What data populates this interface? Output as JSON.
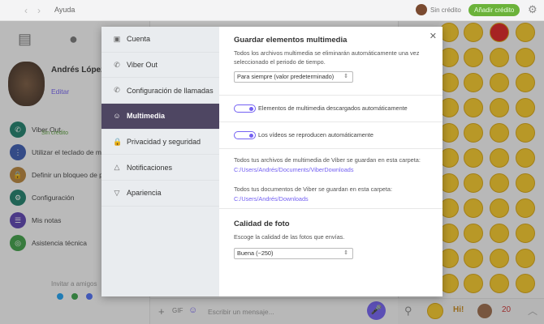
{
  "topbar": {
    "help": "Ayuda",
    "credit_status": "Sin crédito",
    "add_credit": "Añadir crédito"
  },
  "profile": {
    "name": "Andrés López",
    "edit": "Editar"
  },
  "left_menu": [
    {
      "label": "Viber Out",
      "sub": "Sin crédito",
      "color": "#1d7f6a"
    },
    {
      "label": "Utilizar el teclado de ma",
      "color": "#3a5bb0"
    },
    {
      "label": "Definir un bloqueo de p",
      "color": "#b8843a"
    },
    {
      "label": "Configuración",
      "color": "#1d7f6a"
    },
    {
      "label": "Mis notas",
      "color": "#5b41b0"
    },
    {
      "label": "Asistencia técnica",
      "color": "#3e9f47"
    }
  ],
  "invite": "Invitar a amigos",
  "composer": {
    "placeholder": "Escribir un mensaje..."
  },
  "settings": {
    "nav": [
      {
        "label": "Cuenta",
        "icon": "id-card-icon"
      },
      {
        "label": "Viber Out",
        "icon": "phone-out-icon"
      },
      {
        "label": "Configuración de llamadas",
        "icon": "phone-settings-icon"
      },
      {
        "label": "Multimedia",
        "icon": "media-icon",
        "active": true
      },
      {
        "label": "Privacidad y seguridad",
        "icon": "lock-icon"
      },
      {
        "label": "Notificaciones",
        "icon": "bell-icon"
      },
      {
        "label": "Apariencia",
        "icon": "brush-icon"
      }
    ],
    "save_media": {
      "title": "Guardar elementos multimedia",
      "desc": "Todos los archivos multimedia se eliminarán automáticamente una vez seleccionado el periodo de tiempo.",
      "select": "Para siempre (valor predeterminado)"
    },
    "toggles": [
      {
        "label": "Elementos de multimedia descargados automáticamente",
        "on": true
      },
      {
        "label": "Los vídeos se reproducen automáticamente",
        "on": true
      }
    ],
    "media_folder": {
      "label": "Todos tus archivos de multimedia de Viber se guardan en esta carpeta:",
      "path": "C:/Users/Andrés/Documents/ViberDownloads"
    },
    "docs_folder": {
      "label": "Todos tus documentos de Viber se guardan en esta carpeta:",
      "path": "C:/Users/Andrés/Downloads"
    },
    "photo_quality": {
      "title": "Calidad de foto",
      "desc": "Escoge la calidad de las fotos que envías.",
      "select": "Buena (~250)"
    }
  },
  "colors": {
    "accent": "#7360f2",
    "active_nav": "#4e4662",
    "add_credit": "#6bb23a"
  }
}
